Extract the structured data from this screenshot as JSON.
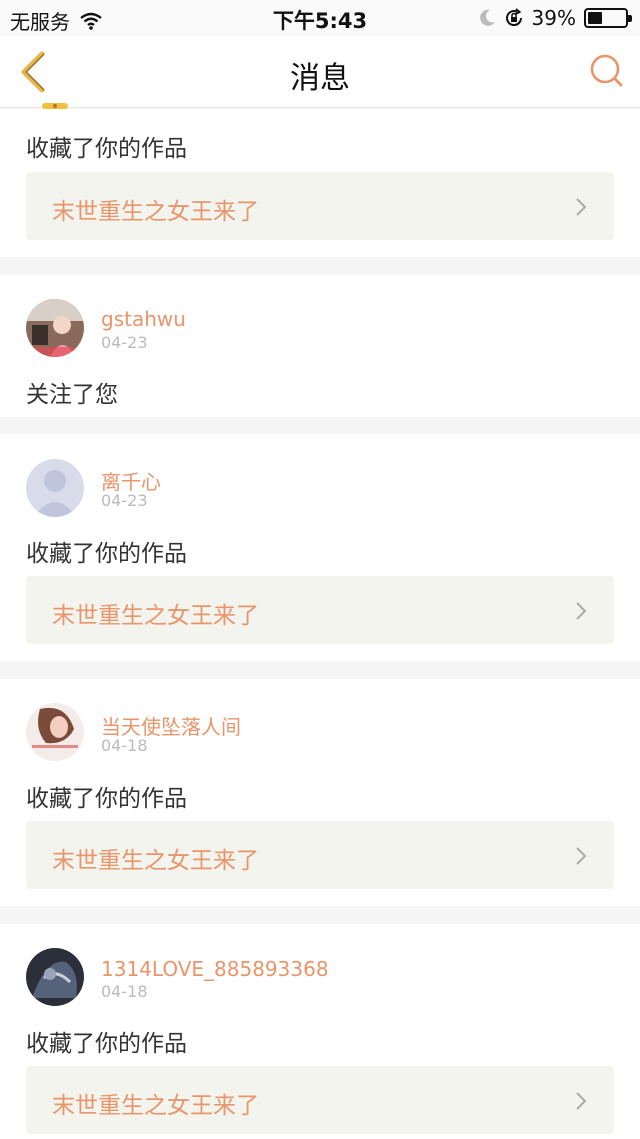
{
  "status_bar": {
    "carrier": "无服务",
    "time": "下午5:43",
    "battery": "39%",
    "battery_level": 0.39
  },
  "header": {
    "title": "消息",
    "back_icon": "chevron-left-icon",
    "search_icon": "search-icon"
  },
  "colors": {
    "accent": "#e8956a",
    "back_icon": "#e8b94a",
    "work_bg": "#f4f4ef"
  },
  "notifications": [
    {
      "action": "收藏了你的作品",
      "work_title": "末世重生之女王来了"
    },
    {
      "username": "gstahwu",
      "date": "04-23",
      "action": "关注了您"
    },
    {
      "username": "离千心",
      "date": "04-23",
      "action": "收藏了你的作品",
      "work_title": "末世重生之女王来了"
    },
    {
      "username": "当天使坠落人间",
      "date": "04-18",
      "action": "收藏了你的作品",
      "work_title": "末世重生之女王来了"
    },
    {
      "username": "1314LOVE_885893368",
      "date": "04-18",
      "action": "收藏了你的作品",
      "work_title": "末世重生之女王来了"
    }
  ]
}
